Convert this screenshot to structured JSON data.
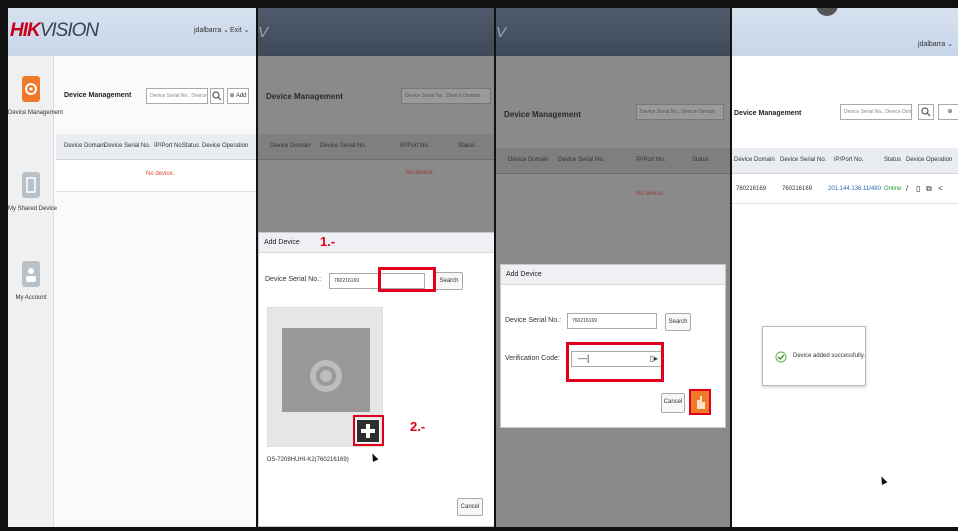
{
  "panels": [
    {
      "logo": {
        "brand": "HIK",
        "rest": "VISION"
      },
      "user_links": {
        "user": "jdalbarra ⌄",
        "exit": "Exit ⌄"
      },
      "sidebar": [
        {
          "label": "Device Management",
          "icon": "device-management-icon"
        },
        {
          "label": "My Shared Device",
          "icon": "shared-device-icon"
        },
        {
          "label": "My Account",
          "icon": "account-icon"
        }
      ],
      "title": "Device Management",
      "search_placeholder": "Device Serial No., Device Domain",
      "add_label": "Add",
      "columns": [
        "Device Domain",
        "Device Serial No.",
        "IP/Port No.",
        "Status",
        "Device Operation"
      ],
      "empty": "No device."
    },
    {
      "title": "Device Management",
      "search_placeholder": "Device Serial No., Device Domain",
      "columns": [
        "Device Domain",
        "Device Serial No.",
        "IP/Port No.",
        "Status"
      ],
      "empty": "No device.",
      "dialog": {
        "title": "Add Device",
        "serial_label": "Device Serial No.:",
        "serial_value": "760216169",
        "search_label": "Search",
        "device_name": "DS-7208HUHI-K2(760216169)",
        "cancel_label": "Cancel"
      },
      "annot1": "1.-",
      "annot2": "2.-"
    },
    {
      "title": "Device Management",
      "search_placeholder": "Device Serial No., Device Domain",
      "columns": [
        "Device Domain",
        "Device Serial No.",
        "IP/Port No.",
        "Status"
      ],
      "empty": "No device.",
      "dialog": {
        "title": "Add Device",
        "serial_label": "Device Serial No.:",
        "serial_value": "760216169",
        "search_label": "Search",
        "verify_label": "Verification Code:",
        "cancel_label": "Cancel"
      }
    },
    {
      "user_links": {
        "user": "jdalbarra ⌄"
      },
      "title": "Device Management",
      "search_placeholder": "Device Serial No., Device Domain",
      "columns": [
        "Device Domain",
        "Device Serial No.",
        "IP/Port No.",
        "Status",
        "Device Operation"
      ],
      "row": [
        "760216169",
        "760216169",
        "201.144.136.11/480",
        "Online"
      ],
      "toast": "Device added successfully."
    }
  ],
  "colors": {
    "brand_red": "#c9001a",
    "annotation_red": "#e0001b",
    "accent_orange": "#f07a2a",
    "online_green": "#2a9a3a"
  }
}
